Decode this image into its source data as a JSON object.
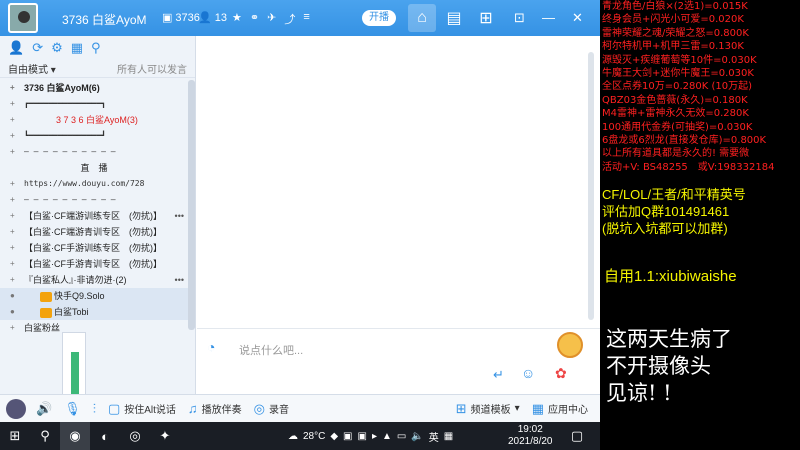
{
  "app": {
    "room_name": "3736 白鲨AyoM",
    "room_id": "3736",
    "members": "13",
    "open_label": "开播"
  },
  "left": {
    "mode_label": "自由模式",
    "mode_right": "所有人可以发言",
    "channels": [
      {
        "text": "3736 白鲨AyoM(6)",
        "kind": "head"
      },
      {
        "text": "┏━━━━━━━━━━━━━━━┓",
        "kind": "small"
      },
      {
        "text": "3 7 3 6 白鲨AyoM(3)",
        "kind": "red"
      },
      {
        "text": "┗━━━━━━━━━━━━━━━┛",
        "kind": "small"
      },
      {
        "text": "— — — — — — — — — —",
        "kind": "small"
      },
      {
        "text": "直　播",
        "kind": "center"
      },
      {
        "text": "https://www.douyu.com/728",
        "kind": "small"
      },
      {
        "text": "— — — — — — — — — —",
        "kind": "small"
      },
      {
        "text": "【白鲨·CF端游训练专区　(勿扰)】",
        "kind": "item"
      },
      {
        "text": "【白鲨·CF端游青训专区　(勿扰)】",
        "kind": "item"
      },
      {
        "text": "【白鲨·CF手游训练专区　(勿扰)】",
        "kind": "item"
      },
      {
        "text": "【白鲨·CF手游青训专区　(勿扰)】",
        "kind": "item"
      },
      {
        "text": "『白鲨私人』·非请勿进·(2)",
        "kind": "item"
      },
      {
        "text": "快手Q9.Solo",
        "kind": "user"
      },
      {
        "text": "白鲨Tobi",
        "kind": "user"
      },
      {
        "text": "白鲨粉丝",
        "kind": "item"
      }
    ],
    "volume_level": 0.85
  },
  "chat": {
    "placeholder": "说点什么吧..."
  },
  "bottombar": {
    "ptt_label": "按住Alt说话",
    "music_label": "播放伴奏",
    "record_label": "录音",
    "template_label": "频道模板",
    "appcenter_label": "应用中心"
  },
  "taskbar": {
    "temperature": "28°C",
    "lang": "英",
    "time": "19:02",
    "date": "2021/8/20"
  },
  "overlay": {
    "red_lines": [
      "青龙角色/白狼×(2选1)=0.015K",
      "终身会员+闪光小可爱=0.020K",
      "雷神荣耀之魂/荣耀之怒=0.800K",
      "柯尔特机甲+机甲三雷=0.130K",
      "源毁灭+疾缠葡萄等10件=0.030K",
      "牛魔王大剑+迷你牛魔王=0.030K",
      "全区点券10万=0.280K (10万起)",
      "QBZ03金色蔷薇(永久)=0.180K",
      "M4雷神+雷神永久无效=0.280K",
      "100通用代金券(可抽奖)=0.030K",
      "6盘龙或6烈龙(直接发仓库)=0.800K",
      "以上所有道具都是永久的! 需要微",
      "活动+V: BS48255　或V:198332184"
    ],
    "yellow_lines": [
      "CF/LOL/王者/和平精英号",
      "评估加Q群101491461",
      "(脱坑入坑都可以加群)"
    ],
    "self_use": "自用1.1:xiubiwaishe",
    "white_lines": [
      "这两天生病了",
      "不开摄像头",
      "见谅! !"
    ]
  }
}
